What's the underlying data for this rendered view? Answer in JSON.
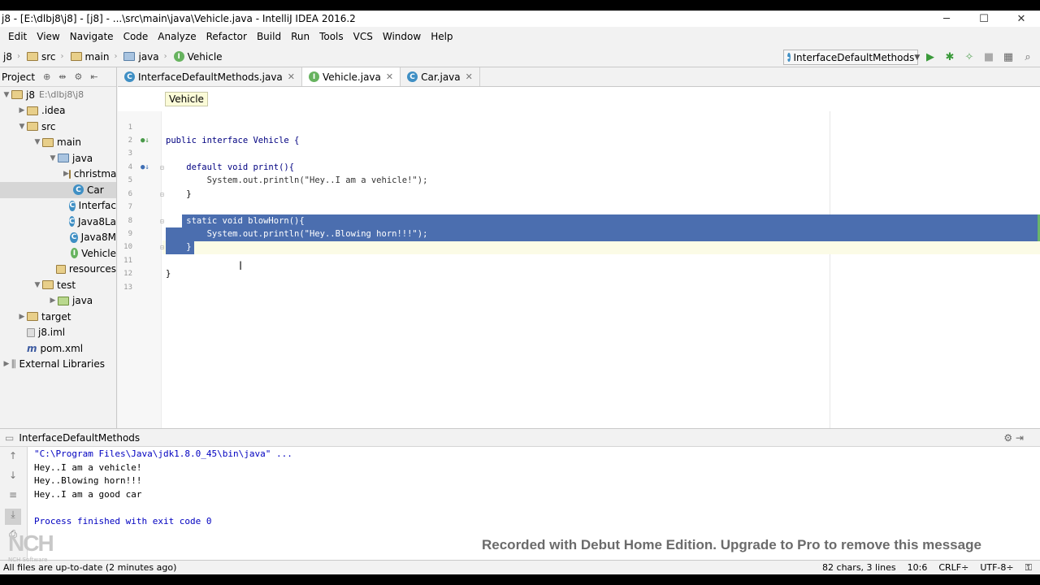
{
  "window": {
    "title": "j8 - [E:\\dlbj8\\j8] - [j8] - ...\\src\\main\\java\\Vehicle.java - IntelliJ IDEA 2016.2",
    "minimize": "─",
    "maximize": "☐",
    "close": "✕"
  },
  "menu": [
    "Edit",
    "View",
    "Navigate",
    "Code",
    "Analyze",
    "Refactor",
    "Build",
    "Run",
    "Tools",
    "VCS",
    "Window",
    "Help"
  ],
  "navbar": {
    "crumbs": [
      "j8",
      "src",
      "main",
      "java",
      "Vehicle"
    ],
    "run_config": "InterfaceDefaultMethods"
  },
  "sidebar": {
    "header": "Project",
    "tree": [
      {
        "label": "j8",
        "extra": "E:\\dlbj8\\j8",
        "level": 0,
        "icon": "folder",
        "arrow": "down"
      },
      {
        "label": ".idea",
        "level": 1,
        "icon": "folder",
        "arrow": "right"
      },
      {
        "label": "src",
        "level": 1,
        "icon": "folder",
        "arrow": "down"
      },
      {
        "label": "main",
        "level": 2,
        "icon": "folder",
        "arrow": "down"
      },
      {
        "label": "java",
        "level": 3,
        "icon": "folder-blue",
        "arrow": "down"
      },
      {
        "label": "christmas",
        "level": 4,
        "icon": "folder",
        "arrow": "right"
      },
      {
        "label": "Car",
        "level": 4,
        "icon": "class",
        "arrow": "",
        "selected": true
      },
      {
        "label": "Interfac",
        "level": 4,
        "icon": "class",
        "arrow": ""
      },
      {
        "label": "Java8La",
        "level": 4,
        "icon": "class",
        "arrow": ""
      },
      {
        "label": "Java8M",
        "level": 4,
        "icon": "class",
        "arrow": ""
      },
      {
        "label": "Vehicle",
        "level": 4,
        "icon": "interface",
        "arrow": ""
      },
      {
        "label": "resources",
        "level": 3,
        "icon": "folder",
        "arrow": ""
      },
      {
        "label": "test",
        "level": 2,
        "icon": "folder",
        "arrow": "down"
      },
      {
        "label": "java",
        "level": 3,
        "icon": "folder-green",
        "arrow": "right"
      },
      {
        "label": "target",
        "level": 1,
        "icon": "folder",
        "arrow": "right"
      },
      {
        "label": "j8.iml",
        "level": 1,
        "icon": "file",
        "arrow": ""
      },
      {
        "label": "pom.xml",
        "level": 1,
        "icon": "maven",
        "arrow": ""
      },
      {
        "label": "External Libraries",
        "level": 0,
        "icon": "lib",
        "arrow": "right"
      }
    ]
  },
  "tabs": [
    {
      "label": "InterfaceDefaultMethods.java",
      "icon": "C",
      "active": false
    },
    {
      "label": "Vehicle.java",
      "icon": "I",
      "active": true
    },
    {
      "label": "Car.java",
      "icon": "C",
      "active": false
    }
  ],
  "editor": {
    "breadcrumb": "Vehicle",
    "line_numbers": [
      "1",
      "2",
      "3",
      "4",
      "5",
      "6",
      "7",
      "8",
      "9",
      "10",
      "11",
      "12",
      "13"
    ],
    "lines": [
      "",
      "public interface Vehicle {",
      "",
      "    default void print(){",
      "        System.out.println(\"Hey..I am a vehicle!\");",
      "    }",
      "",
      "    static void blowHorn(){",
      "        System.out.println(\"Hey..Blowing horn!!!\");",
      "    }",
      "",
      "}",
      ""
    ]
  },
  "run_panel": {
    "title": "InterfaceDefaultMethods",
    "console": [
      "\"C:\\Program Files\\Java\\jdk1.8.0_45\\bin\\java\" ...",
      "Hey..I am a vehicle!",
      "Hey..Blowing horn!!!",
      "Hey..I am a good car",
      "",
      "Process finished with exit code 0"
    ]
  },
  "status": {
    "message": "All files are up-to-date (2 minutes ago)",
    "chars": "82 chars, 3 lines",
    "position": "10:6",
    "line_sep": "CRLF÷",
    "encoding": "UTF-8÷"
  },
  "watermark": {
    "text": "Recorded with Debut Home Edition. Upgrade to Pro to remove this message",
    "logo": "NCH",
    "logo_sub": "NCH Software"
  }
}
